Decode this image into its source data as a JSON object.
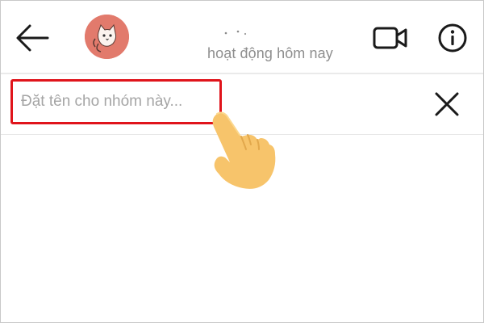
{
  "header": {
    "back_icon": "arrow-left-icon",
    "avatar_icon": "cat-avatar",
    "avatar_color": "#e27a6c",
    "status_text": "hoạt động hôm nay",
    "video_call_icon": "video-camera-icon",
    "info_icon": "info-circle-icon"
  },
  "group_name": {
    "placeholder": "Đặt tên cho nhóm này...",
    "value": "",
    "highlight_color": "#e0141b",
    "clear_icon": "close-icon"
  },
  "overlay": {
    "pointer_icon": "pointing-hand-icon"
  }
}
